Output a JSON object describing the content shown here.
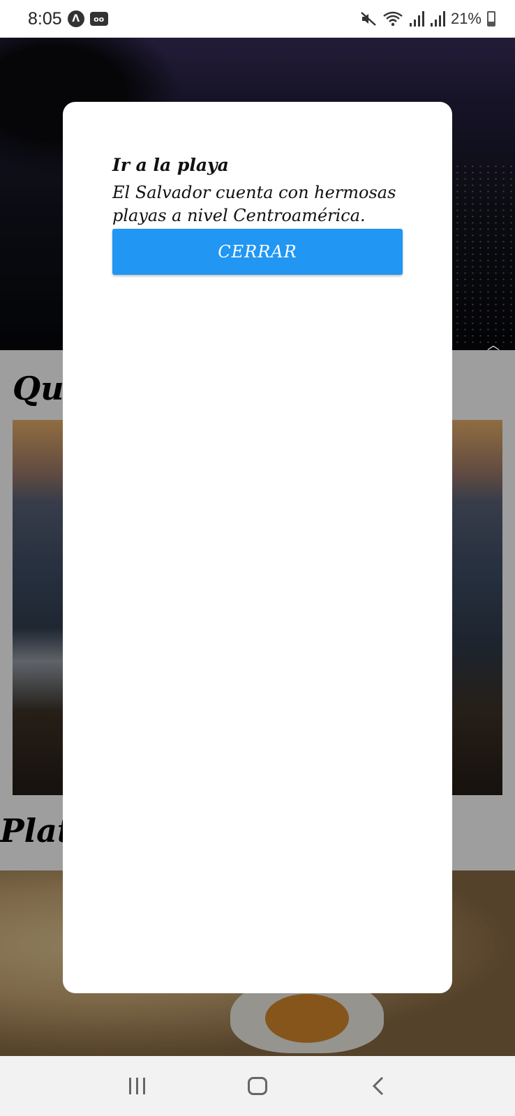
{
  "status_bar": {
    "time": "8:05",
    "left_icons": [
      "app-a-badge-icon",
      "voicemail-icon"
    ],
    "right_icons": [
      "mute-icon",
      "wifi-icon",
      "signal-icon",
      "signal-icon",
      "battery-icon"
    ],
    "battery_percent": "21%",
    "battery_level": 0.21
  },
  "background": {
    "section_title_1": "Que",
    "section_title_2": "Plati"
  },
  "modal": {
    "title": "Ir a la playa",
    "body": "El Salvador cuenta con hermosas playas a nivel Centroamérica.",
    "close_label": "CERRAR",
    "accent_color": "#2196f3"
  },
  "nav_bar": {
    "buttons": [
      "recents",
      "home",
      "back"
    ]
  }
}
